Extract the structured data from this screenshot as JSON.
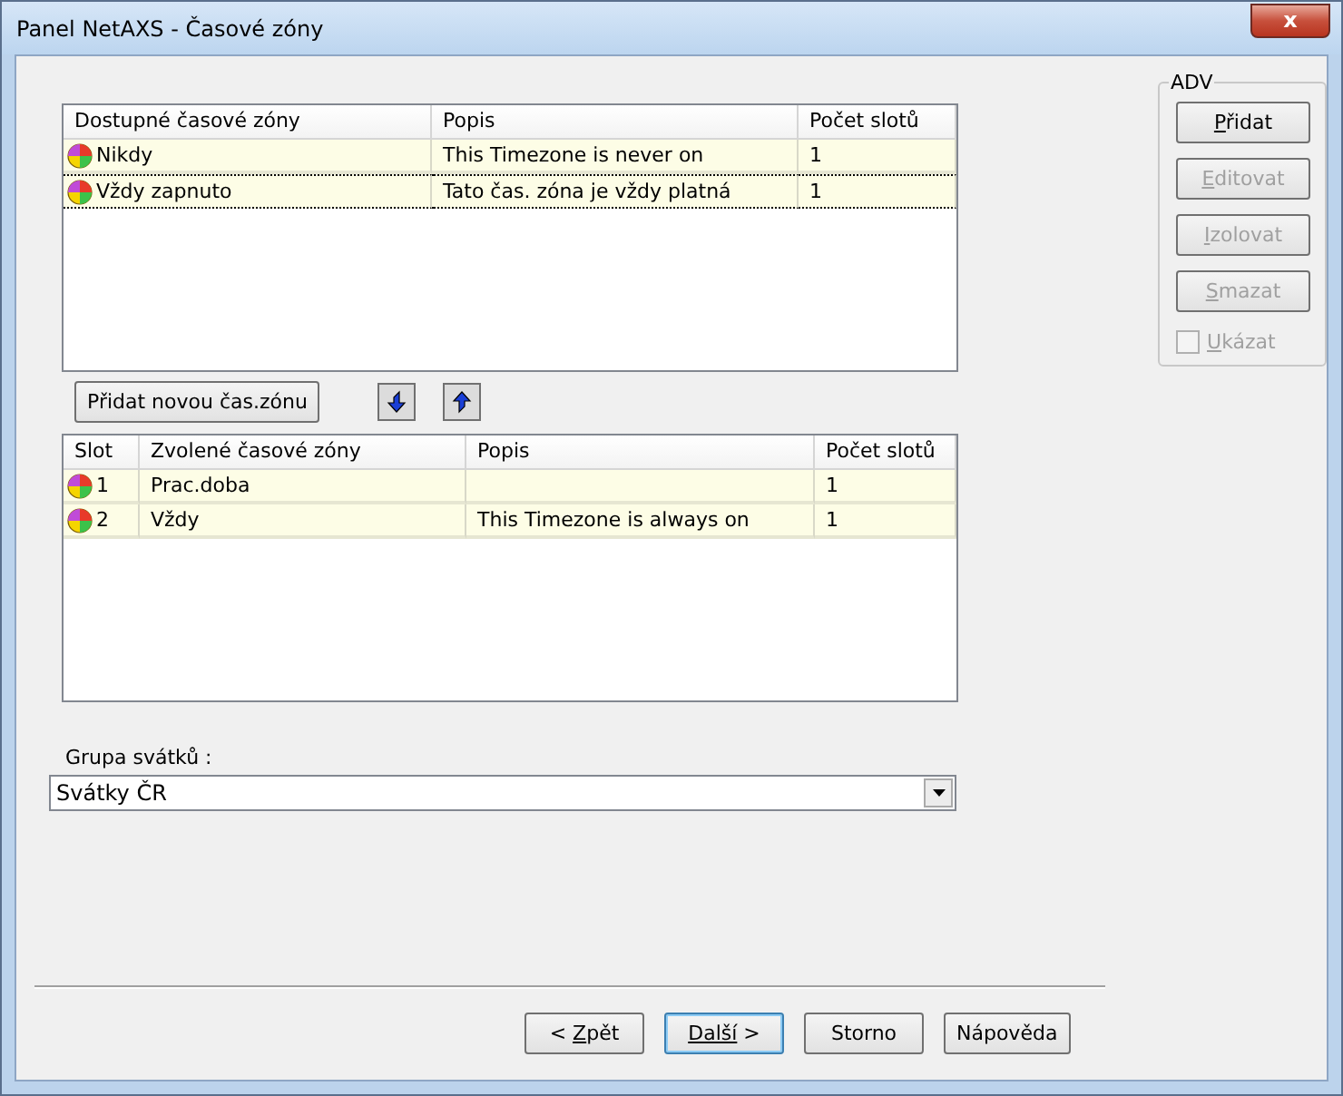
{
  "window": {
    "title": "Panel NetAXS - Časové zóny",
    "close": "x"
  },
  "available_table": {
    "columns": [
      "Dostupné časové zóny",
      "Popis",
      "Počet slotů"
    ],
    "rows": [
      {
        "cells": [
          "Nikdy",
          "This Timezone is never on",
          "1"
        ],
        "selected": false
      },
      {
        "cells": [
          "Vždy zapnuto",
          "Tato čas. zóna je vždy platná",
          "1"
        ],
        "selected": true
      }
    ]
  },
  "add_zone_button": "Přidat novou čas.zónu",
  "chosen_table": {
    "columns": [
      "Slot",
      "Zvolené časové zóny",
      "Popis",
      "Počet slotů"
    ],
    "rows": [
      {
        "cells": [
          "1",
          "Prac.doba",
          null,
          "1"
        ],
        "selected": false
      },
      {
        "cells": [
          "2",
          "Vždy",
          "This Timezone is always on",
          "1"
        ],
        "selected": false
      }
    ]
  },
  "holiday_group": {
    "label": "Grupa svátků :",
    "value": "Svátky ČR"
  },
  "adv": {
    "title": "ADV",
    "buttons": [
      {
        "key": "P",
        "post": "řidat",
        "disabled": false
      },
      {
        "key": "E",
        "post": "ditovat",
        "disabled": true
      },
      {
        "key": "I",
        "post": "zolovat",
        "disabled": true
      },
      {
        "key": "S",
        "post": "mazat",
        "disabled": true
      }
    ],
    "checkbox": {
      "key": "U",
      "post": "kázat",
      "checked": false,
      "disabled": true
    }
  },
  "footer_buttons": [
    {
      "pre": "< ",
      "key": "Z",
      "post": "pět",
      "default": false
    },
    {
      "key": "Další",
      "post": " >",
      "default": true
    },
    {
      "pre": "Storno",
      "default": false
    },
    {
      "pre": "Nápověda",
      "default": false
    }
  ]
}
